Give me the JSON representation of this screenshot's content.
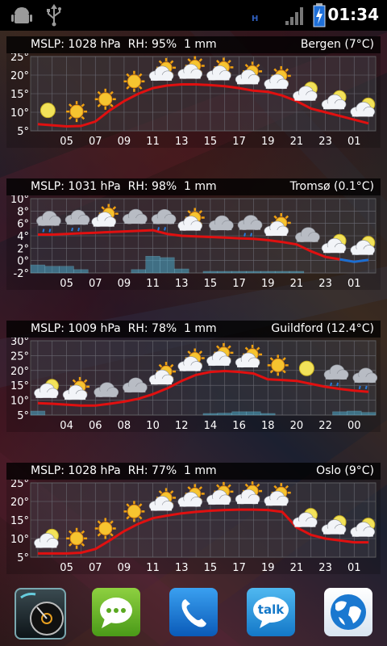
{
  "status_bar": {
    "time": "01:34",
    "icons": [
      "android-debug-icon",
      "usb-icon",
      "signal-icon",
      "battery-charging-icon"
    ],
    "small_label": "H"
  },
  "widgets": [
    {
      "header_left": "MSLP: 1028 hPa  RH: 95%  1 mm",
      "header_right": "Bergen (7°C)",
      "y_ticks": [
        "25°",
        "20°",
        "15°",
        "10°",
        "5°"
      ],
      "x_ticks": [
        "05",
        "07",
        "09",
        "11",
        "13",
        "15",
        "17",
        "19",
        "21",
        "23",
        "01"
      ],
      "chart_data": {
        "type": "line",
        "xlabel": "",
        "ylabel": "",
        "ylim": [
          5,
          25
        ],
        "x": [
          3,
          4,
          5,
          6,
          7,
          8,
          9,
          10,
          11,
          12,
          13,
          14,
          15,
          16,
          17,
          18,
          19,
          20,
          21,
          22,
          23,
          24,
          25,
          26
        ],
        "series": [
          {
            "values": [
              6.8,
              6.5,
              6.2,
              6.3,
              7.5,
              10.5,
              13,
              15,
              16.5,
              17.2,
              17.5,
              17.5,
              17.3,
              17,
              16.5,
              15.8,
              15.5,
              14.5,
              13,
              11,
              10,
              9,
              8,
              7
            ]
          }
        ],
        "icons": [
          {
            "hour": 3.7,
            "type": "moon"
          },
          {
            "hour": 5.7,
            "type": "sun"
          },
          {
            "hour": 7.7,
            "type": "sun"
          },
          {
            "hour": 9.7,
            "type": "sun"
          },
          {
            "hour": 11.7,
            "type": "sun-cloud"
          },
          {
            "hour": 13.7,
            "type": "sun-cloud"
          },
          {
            "hour": 15.7,
            "type": "sun-cloud"
          },
          {
            "hour": 17.7,
            "type": "sun-cloud"
          },
          {
            "hour": 19.7,
            "type": "sun-cloud"
          },
          {
            "hour": 21.7,
            "type": "moon-cloud"
          },
          {
            "hour": 23.7,
            "type": "moon-cloud"
          },
          {
            "hour": 25.7,
            "type": "moon-cloud"
          }
        ]
      }
    },
    {
      "header_left": "MSLP: 1031 hPa  RH: 98%  1 mm",
      "header_right": "Tromsø (0.1°C)",
      "y_ticks": [
        "10°",
        "8°",
        "6°",
        "4°",
        "2°",
        "0°",
        "-2°"
      ],
      "x_ticks": [
        "05",
        "07",
        "09",
        "11",
        "13",
        "15",
        "17",
        "19",
        "21",
        "23",
        "01"
      ],
      "chart_data": {
        "type": "line",
        "xlabel": "",
        "ylabel": "",
        "ylim": [
          -2,
          10
        ],
        "x": [
          3,
          4,
          5,
          6,
          7,
          8,
          9,
          10,
          11,
          12,
          13,
          14,
          15,
          16,
          17,
          18,
          19,
          20,
          21,
          22,
          23,
          24,
          25,
          26
        ],
        "series": [
          {
            "values": [
              4.2,
              4.2,
              4.3,
              4.4,
              4.5,
              4.6,
              4.7,
              4.8,
              4.9,
              4.3,
              4.0,
              3.9,
              3.8,
              3.7,
              3.6,
              3.5,
              3.3,
              3.0,
              2.6,
              1.5,
              0.6,
              0.2,
              -0.2,
              0.1
            ]
          }
        ],
        "precip": [
          1.2,
          1.0,
          1.0,
          0.5,
          0.0,
          0.0,
          0.0,
          0.5,
          2.5,
          2.3,
          0.6,
          0.0,
          0.2,
          0.2,
          0.2,
          0.2,
          0.1,
          0.1,
          0.1,
          0.0,
          0.0,
          0.0,
          0.0,
          0.0
        ],
        "icons": [
          {
            "hour": 3.7,
            "type": "cloud-rain"
          },
          {
            "hour": 5.7,
            "type": "cloud-rain"
          },
          {
            "hour": 7.7,
            "type": "sun-cloud"
          },
          {
            "hour": 9.7,
            "type": "cloud"
          },
          {
            "hour": 11.7,
            "type": "cloud-rain"
          },
          {
            "hour": 13.7,
            "type": "sun-cloud"
          },
          {
            "hour": 15.7,
            "type": "cloud"
          },
          {
            "hour": 17.7,
            "type": "cloud-rain"
          },
          {
            "hour": 19.7,
            "type": "sun-cloud"
          },
          {
            "hour": 21.7,
            "type": "cloud"
          },
          {
            "hour": 23.7,
            "type": "moon-cloud"
          },
          {
            "hour": 25.7,
            "type": "moon-cloud"
          }
        ]
      }
    },
    {
      "header_left": "MSLP: 1009 hPa  RH: 78%  1 mm",
      "header_right": "Guildford (12.4°C)",
      "y_ticks": [
        "30°",
        "25°",
        "20°",
        "15°",
        "10°",
        "5°"
      ],
      "x_ticks": [
        "04",
        "06",
        "08",
        "10",
        "12",
        "14",
        "16",
        "18",
        "20",
        "22",
        "00"
      ],
      "chart_data": {
        "type": "line",
        "xlabel": "",
        "ylabel": "",
        "ylim": [
          5,
          30
        ],
        "x": [
          2,
          3,
          4,
          5,
          6,
          7,
          8,
          9,
          10,
          11,
          12,
          13,
          14,
          15,
          16,
          17,
          18,
          19,
          20,
          21,
          22,
          23,
          24,
          25
        ],
        "series": [
          {
            "values": [
              9,
              8.8,
              8.5,
              8.2,
              8.2,
              8.8,
              9.5,
              10.5,
              12,
              14,
              16.5,
              18.5,
              19.5,
              19.8,
              19.5,
              19,
              17,
              16.8,
              16.5,
              15.5,
              14.5,
              13.8,
              13.2,
              12.8
            ]
          }
        ],
        "precip": [
          0.6,
          0.0,
          0.0,
          0.0,
          0.0,
          0.0,
          0.0,
          0.0,
          0.0,
          0.0,
          0.0,
          0.0,
          0.2,
          0.3,
          0.5,
          0.5,
          0.2,
          0.0,
          0.0,
          0.0,
          0.0,
          0.5,
          0.6,
          0.4
        ],
        "icons": [
          {
            "hour": 2.7,
            "type": "moon-cloud"
          },
          {
            "hour": 4.7,
            "type": "sun-cloud"
          },
          {
            "hour": 6.7,
            "type": "cloud"
          },
          {
            "hour": 8.7,
            "type": "cloud"
          },
          {
            "hour": 10.7,
            "type": "sun-cloud"
          },
          {
            "hour": 12.7,
            "type": "sun-cloud"
          },
          {
            "hour": 14.7,
            "type": "sun-cloud"
          },
          {
            "hour": 16.7,
            "type": "sun-cloud"
          },
          {
            "hour": 18.7,
            "type": "sun"
          },
          {
            "hour": 20.7,
            "type": "moon"
          },
          {
            "hour": 22.7,
            "type": "cloud-rain"
          },
          {
            "hour": 24.7,
            "type": "cloud-rain"
          }
        ]
      }
    },
    {
      "header_left": "MSLP: 1028 hPa  RH: 77%  1 mm",
      "header_right": "Oslo (9°C)",
      "y_ticks": [
        "25°",
        "20°",
        "15°",
        "10°",
        "5°"
      ],
      "x_ticks": [
        "05",
        "07",
        "09",
        "11",
        "13",
        "15",
        "17",
        "19",
        "21",
        "23",
        "01"
      ],
      "chart_data": {
        "type": "line",
        "xlabel": "",
        "ylabel": "",
        "ylim": [
          5,
          25
        ],
        "x": [
          3,
          4,
          5,
          6,
          7,
          8,
          9,
          10,
          11,
          12,
          13,
          14,
          15,
          16,
          17,
          18,
          19,
          20,
          21,
          22,
          23,
          24,
          25,
          26
        ],
        "series": [
          {
            "values": [
              6,
              6,
              6,
              6.2,
              7.2,
              9.5,
              12,
              14,
              15.5,
              16.2,
              16.8,
              17.2,
              17.5,
              17.7,
              17.8,
              17.8,
              17.7,
              17.2,
              13,
              11,
              10,
              9.5,
              9,
              9
            ]
          }
        ],
        "icons": [
          {
            "hour": 3.7,
            "type": "moon-cloud"
          },
          {
            "hour": 5.7,
            "type": "sun"
          },
          {
            "hour": 7.7,
            "type": "sun"
          },
          {
            "hour": 9.7,
            "type": "sun"
          },
          {
            "hour": 11.7,
            "type": "sun-cloud"
          },
          {
            "hour": 13.7,
            "type": "sun-cloud"
          },
          {
            "hour": 15.7,
            "type": "sun-cloud"
          },
          {
            "hour": 17.7,
            "type": "sun-cloud"
          },
          {
            "hour": 19.7,
            "type": "sun-cloud"
          },
          {
            "hour": 21.7,
            "type": "moon-cloud"
          },
          {
            "hour": 23.7,
            "type": "moon-cloud"
          },
          {
            "hour": 25.7,
            "type": "moon-cloud"
          }
        ]
      }
    }
  ],
  "dock": {
    "apps": [
      {
        "name": "clock-app-icon"
      },
      {
        "name": "messaging-app-icon"
      },
      {
        "name": "phone-app-icon"
      },
      {
        "name": "talk-app-icon",
        "label": "talk"
      },
      {
        "name": "browser-app-icon"
      }
    ]
  },
  "colors": {
    "temp_line": "#e01010",
    "temp_line_cold": "#1a6fd0",
    "precip": "#4aa8c8"
  }
}
